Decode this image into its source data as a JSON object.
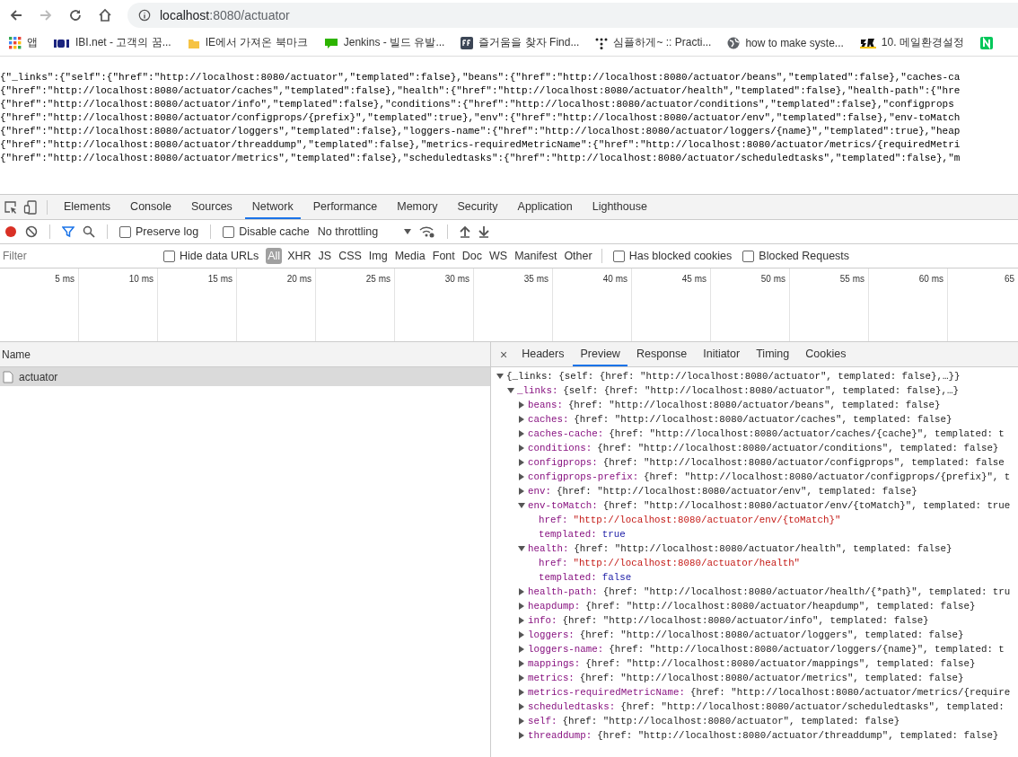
{
  "browser": {
    "url_host": "localhost",
    "url_path": ":8080/actuator",
    "back_disabled": false,
    "forward_disabled": true
  },
  "bookmarks": [
    {
      "kind": "apps",
      "label": "앱"
    },
    {
      "kind": "ibi",
      "label": "IBI.net - 고객의 꿈..."
    },
    {
      "kind": "folder",
      "label": "IE에서 가져온 북마크"
    },
    {
      "kind": "blog",
      "label": "Jenkins - 빌드 유발..."
    },
    {
      "kind": "ff",
      "label": "즐거움을 찾자 Find..."
    },
    {
      "kind": "dots",
      "label": "심플하게~ :: Practi..."
    },
    {
      "kind": "globe",
      "label": "how to make syste..."
    },
    {
      "kind": "brand",
      "label": "10. 메일환경설정"
    },
    {
      "kind": "n"
    }
  ],
  "page_lines": [
    "{\"_links\":{\"self\":{\"href\":\"http://localhost:8080/actuator\",\"templated\":false},\"beans\":{\"href\":\"http://localhost:8080/actuator/beans\",\"templated\":false},\"caches-ca",
    "{\"href\":\"http://localhost:8080/actuator/caches\",\"templated\":false},\"health\":{\"href\":\"http://localhost:8080/actuator/health\",\"templated\":false},\"health-path\":{\"hre",
    "{\"href\":\"http://localhost:8080/actuator/info\",\"templated\":false},\"conditions\":{\"href\":\"http://localhost:8080/actuator/conditions\",\"templated\":false},\"configprops",
    "{\"href\":\"http://localhost:8080/actuator/configprops/{prefix}\",\"templated\":true},\"env\":{\"href\":\"http://localhost:8080/actuator/env\",\"templated\":false},\"env-toMatch",
    "{\"href\":\"http://localhost:8080/actuator/loggers\",\"templated\":false},\"loggers-name\":{\"href\":\"http://localhost:8080/actuator/loggers/{name}\",\"templated\":true},\"heap",
    "{\"href\":\"http://localhost:8080/actuator/threaddump\",\"templated\":false},\"metrics-requiredMetricName\":{\"href\":\"http://localhost:8080/actuator/metrics/{requiredMetri",
    "{\"href\":\"http://localhost:8080/actuator/metrics\",\"templated\":false},\"scheduledtasks\":{\"href\":\"http://localhost:8080/actuator/scheduledtasks\",\"templated\":false},\"m"
  ],
  "devtools": {
    "tabs": [
      {
        "label": "Elements",
        "selected": false
      },
      {
        "label": "Console",
        "selected": false
      },
      {
        "label": "Sources",
        "selected": false
      },
      {
        "label": "Network",
        "selected": true
      },
      {
        "label": "Performance",
        "selected": false
      },
      {
        "label": "Memory",
        "selected": false
      },
      {
        "label": "Security",
        "selected": false
      },
      {
        "label": "Application",
        "selected": false
      },
      {
        "label": "Lighthouse",
        "selected": false
      }
    ],
    "preserve_log": {
      "label": "Preserve log",
      "checked": false
    },
    "disable_cache": {
      "label": "Disable cache",
      "checked": false
    },
    "throttling": "No throttling",
    "filter": {
      "placeholder": "Filter"
    },
    "hide_data_urls": {
      "label": "Hide data URLs",
      "checked": false
    },
    "types": [
      {
        "label": "All",
        "selected": true
      },
      {
        "label": "XHR",
        "selected": false
      },
      {
        "label": "JS",
        "selected": false
      },
      {
        "label": "CSS",
        "selected": false
      },
      {
        "label": "Img",
        "selected": false
      },
      {
        "label": "Media",
        "selected": false
      },
      {
        "label": "Font",
        "selected": false
      },
      {
        "label": "Doc",
        "selected": false
      },
      {
        "label": "WS",
        "selected": false
      },
      {
        "label": "Manifest",
        "selected": false
      },
      {
        "label": "Other",
        "selected": false
      }
    ],
    "blocked_cookies": {
      "label": "Has blocked cookies",
      "checked": false
    },
    "blocked_requests": {
      "label": "Blocked Requests",
      "checked": false
    },
    "timeline_ticks": [
      "5 ms",
      "10 ms",
      "15 ms",
      "20 ms",
      "25 ms",
      "30 ms",
      "35 ms",
      "40 ms",
      "45 ms",
      "50 ms",
      "55 ms",
      "60 ms",
      "65"
    ],
    "name_header": "Name",
    "requests": [
      {
        "name": "actuator",
        "selected": true
      }
    ],
    "close": "×",
    "detail_tabs": [
      {
        "label": "Headers",
        "selected": false
      },
      {
        "label": "Preview",
        "selected": true
      },
      {
        "label": "Response",
        "selected": false
      },
      {
        "label": "Initiator",
        "selected": false
      },
      {
        "label": "Timing",
        "selected": false
      },
      {
        "label": "Cookies",
        "selected": false
      }
    ],
    "preview": [
      {
        "kind": "object",
        "summary": "{_links: {self: {href: \"http://localhost:8080/actuator\", templated: false},…}}",
        "expanded": true,
        "children": [
          {
            "kind": "object",
            "key": "_links:",
            "summary": "{self: {href: \"http://localhost:8080/actuator\", templated: false},…}",
            "expanded": true,
            "children": [
              {
                "kind": "object",
                "key": "beans:",
                "summary": "{href: \"http://localhost:8080/actuator/beans\", templated: false}",
                "expanded": false
              },
              {
                "kind": "object",
                "key": "caches:",
                "summary": "{href: \"http://localhost:8080/actuator/caches\", templated: false}",
                "expanded": false
              },
              {
                "kind": "object",
                "key": "caches-cache:",
                "summary": "{href: \"http://localhost:8080/actuator/caches/{cache}\", templated: t",
                "expanded": false
              },
              {
                "kind": "object",
                "key": "conditions:",
                "summary": "{href: \"http://localhost:8080/actuator/conditions\", templated: false}",
                "expanded": false
              },
              {
                "kind": "object",
                "key": "configprops:",
                "summary": "{href: \"http://localhost:8080/actuator/configprops\", templated: false",
                "expanded": false
              },
              {
                "kind": "object",
                "key": "configprops-prefix:",
                "summary": "{href: \"http://localhost:8080/actuator/configprops/{prefix}\", t",
                "expanded": false
              },
              {
                "kind": "object",
                "key": "env:",
                "summary": "{href: \"http://localhost:8080/actuator/env\", templated: false}",
                "expanded": false
              },
              {
                "kind": "object",
                "key": "env-toMatch:",
                "summary": "{href: \"http://localhost:8080/actuator/env/{toMatch}\", templated: true",
                "expanded": true,
                "children": [
                  {
                    "kind": "string",
                    "key": "href:",
                    "value": "\"http://localhost:8080/actuator/env/{toMatch}\""
                  },
                  {
                    "kind": "boolean",
                    "key": "templated:",
                    "value": "true"
                  }
                ]
              },
              {
                "kind": "object",
                "key": "health:",
                "summary": "{href: \"http://localhost:8080/actuator/health\", templated: false}",
                "expanded": true,
                "children": [
                  {
                    "kind": "string",
                    "key": "href:",
                    "value": "\"http://localhost:8080/actuator/health\""
                  },
                  {
                    "kind": "boolean",
                    "key": "templated:",
                    "value": "false"
                  }
                ]
              },
              {
                "kind": "object",
                "key": "health-path:",
                "summary": "{href: \"http://localhost:8080/actuator/health/{*path}\", templated: tru",
                "expanded": false
              },
              {
                "kind": "object",
                "key": "heapdump:",
                "summary": "{href: \"http://localhost:8080/actuator/heapdump\", templated: false}",
                "expanded": false
              },
              {
                "kind": "object",
                "key": "info:",
                "summary": "{href: \"http://localhost:8080/actuator/info\", templated: false}",
                "expanded": false
              },
              {
                "kind": "object",
                "key": "loggers:",
                "summary": "{href: \"http://localhost:8080/actuator/loggers\", templated: false}",
                "expanded": false
              },
              {
                "kind": "object",
                "key": "loggers-name:",
                "summary": "{href: \"http://localhost:8080/actuator/loggers/{name}\", templated: t",
                "expanded": false
              },
              {
                "kind": "object",
                "key": "mappings:",
                "summary": "{href: \"http://localhost:8080/actuator/mappings\", templated: false}",
                "expanded": false
              },
              {
                "kind": "object",
                "key": "metrics:",
                "summary": "{href: \"http://localhost:8080/actuator/metrics\", templated: false}",
                "expanded": false
              },
              {
                "kind": "object",
                "key": "metrics-requiredMetricName:",
                "summary": "{href: \"http://localhost:8080/actuator/metrics/{require",
                "expanded": false
              },
              {
                "kind": "object",
                "key": "scheduledtasks:",
                "summary": "{href: \"http://localhost:8080/actuator/scheduledtasks\", templated:",
                "expanded": false
              },
              {
                "kind": "object",
                "key": "self:",
                "summary": "{href: \"http://localhost:8080/actuator\", templated: false}",
                "expanded": false
              },
              {
                "kind": "object",
                "key": "threaddump:",
                "summary": "{href: \"http://localhost:8080/actuator/threaddump\", templated: false}",
                "expanded": false
              }
            ]
          }
        ]
      }
    ]
  }
}
